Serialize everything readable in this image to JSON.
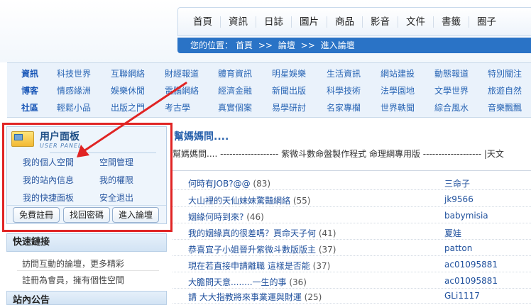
{
  "nav": {
    "items": [
      "首頁",
      "資訊",
      "日誌",
      "圖片",
      "商品",
      "影音",
      "文件",
      "書籤",
      "圈子"
    ]
  },
  "breadcrumb": {
    "label": "您的位置：",
    "home": "首頁",
    "sep1": ">>",
    "forum": "論壇",
    "sep2": ">>",
    "current": "進入論壇"
  },
  "categories": {
    "rows": [
      {
        "head": "資訊",
        "items": [
          "科技世界",
          "互聯網絡",
          "財經報道",
          "體育資訊",
          "明星娛樂",
          "生活資訊",
          "網站建設",
          "動態報道",
          "特別關注"
        ]
      },
      {
        "head": "博客",
        "items": [
          "情感緣洲",
          "娛樂休閒",
          "電腦網絡",
          "經濟金融",
          "新聞出版",
          "科學技術",
          "法學園地",
          "文學世界",
          "旅遊自然"
        ]
      },
      {
        "head": "社區",
        "items": [
          "輕鬆小品",
          "出版之門",
          "考古學",
          "真實個案",
          "易學研討",
          "名家專欄",
          "世界軼聞",
          "綜合風水",
          "音樂飄飄"
        ]
      }
    ]
  },
  "user_panel": {
    "title": "用户面板",
    "subtitle": "USER PANEL",
    "links": [
      "我的個人空間",
      "空間管理",
      "我的站內信息",
      "我的權限",
      "我的快捷面板",
      "安全退出"
    ],
    "buttons": [
      "免費註冊",
      "找回密碼",
      "進入論壇"
    ]
  },
  "quick_links": {
    "title": "快速鏈接",
    "items": [
      "訪問互動的論壇，更多精彩",
      "註冊為會員，擁有個性空間"
    ]
  },
  "bottom_box": {
    "title": "站內公告"
  },
  "content": {
    "title": "幫媽媽問....",
    "marquee": "幫媽媽問.... ------------------- 紫微斗數命盤製作程式 命理網專用版 ------------------- |天文",
    "posts": [
      {
        "title": "何時有JOB?@@",
        "count": "(83)",
        "author": "三命子"
      },
      {
        "title": "大山裡的天仙妹妹驚豔網絡",
        "count": "(55)",
        "author": "jk9566"
      },
      {
        "title": "姻緣何時到來?",
        "count": "(46)",
        "author": "babymisia"
      },
      {
        "title": "我的姻緣真的很差嗎？頁命天子何",
        "count": "(41)",
        "author": "夏娃"
      },
      {
        "title": "恭喜宜子小姐晉升紫微斗數版版主",
        "count": "(37)",
        "author": "patton"
      },
      {
        "title": "現在若直接申請離職 這樣是否能",
        "count": "(37)",
        "author": "ac01095881"
      },
      {
        "title": "大膽問天意........一生的事",
        "count": "(36)",
        "author": "ac01095881"
      },
      {
        "title": "請 大大指教將來事業運與財運",
        "count": "(25)",
        "author": "GLi1117"
      }
    ]
  },
  "colors": {
    "accent_blue": "#2a73c6",
    "highlight_red": "#e02424"
  }
}
